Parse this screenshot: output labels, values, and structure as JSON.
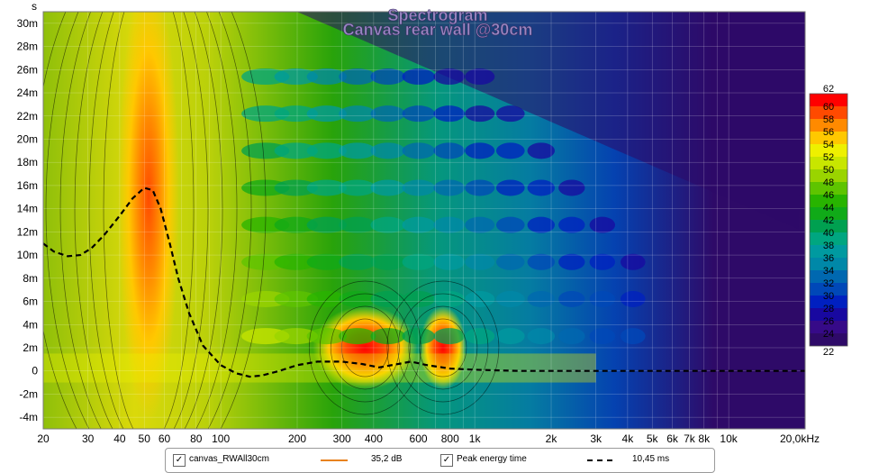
{
  "chart_data": {
    "type": "heatmap",
    "title": "Spectrogram",
    "subtitle": "Canvas rear wall @30cm",
    "x_axis": {
      "scale": "log",
      "range_hz": [
        20,
        20000
      ],
      "ticks": [
        {
          "v": 20,
          "label": "20"
        },
        {
          "v": 30,
          "label": "30"
        },
        {
          "v": 40,
          "label": "40"
        },
        {
          "v": 50,
          "label": "50"
        },
        {
          "v": 60,
          "label": "60"
        },
        {
          "v": 80,
          "label": "80"
        },
        {
          "v": 100,
          "label": "100"
        },
        {
          "v": 200,
          "label": "200"
        },
        {
          "v": 300,
          "label": "300"
        },
        {
          "v": 400,
          "label": "400"
        },
        {
          "v": 600,
          "label": "600"
        },
        {
          "v": 800,
          "label": "800"
        },
        {
          "v": 1000,
          "label": "1k"
        },
        {
          "v": 2000,
          "label": "2k"
        },
        {
          "v": 3000,
          "label": "3k"
        },
        {
          "v": 4000,
          "label": "4k"
        },
        {
          "v": 5000,
          "label": "5k"
        },
        {
          "v": 6000,
          "label": "6k"
        },
        {
          "v": 7000,
          "label": "7k"
        },
        {
          "v": 8000,
          "label": "8k"
        },
        {
          "v": 10000,
          "label": "10k"
        },
        {
          "v": 20000,
          "label": "20,0kHz"
        }
      ]
    },
    "y_axis": {
      "unit_label": "s",
      "range_ms": [
        -5,
        31
      ],
      "ticks": [
        {
          "v": 30,
          "label": "30m"
        },
        {
          "v": 28,
          "label": "28m"
        },
        {
          "v": 26,
          "label": "26m"
        },
        {
          "v": 24,
          "label": "24m"
        },
        {
          "v": 22,
          "label": "22m"
        },
        {
          "v": 20,
          "label": "20m"
        },
        {
          "v": 18,
          "label": "18m"
        },
        {
          "v": 16,
          "label": "16m"
        },
        {
          "v": 14,
          "label": "14m"
        },
        {
          "v": 12,
          "label": "12m"
        },
        {
          "v": 10,
          "label": "10m"
        },
        {
          "v": 8,
          "label": "8m"
        },
        {
          "v": 6,
          "label": "6m"
        },
        {
          "v": 4,
          "label": "4m"
        },
        {
          "v": 2,
          "label": "2m"
        },
        {
          "v": 0,
          "label": "0"
        },
        {
          "v": -2,
          "label": "-2m"
        },
        {
          "v": -4,
          "label": "-4m"
        }
      ]
    },
    "color_scale": {
      "unit": "dB",
      "min": 22,
      "max": 62,
      "levels": [
        {
          "db": 60,
          "color": "#ff0000"
        },
        {
          "db": 58,
          "color": "#ff4a00"
        },
        {
          "db": 56,
          "color": "#ff8a00"
        },
        {
          "db": 54,
          "color": "#ffc800"
        },
        {
          "db": 52,
          "color": "#eef000"
        },
        {
          "db": 50,
          "color": "#c8e600"
        },
        {
          "db": 48,
          "color": "#9ad400"
        },
        {
          "db": 46,
          "color": "#5ec400"
        },
        {
          "db": 44,
          "color": "#28b400"
        },
        {
          "db": 42,
          "color": "#10aa18"
        },
        {
          "db": 40,
          "color": "#00a050"
        },
        {
          "db": 38,
          "color": "#00a680"
        },
        {
          "db": 36,
          "color": "#009aa0"
        },
        {
          "db": 34,
          "color": "#0088a8"
        },
        {
          "db": 32,
          "color": "#0068b0"
        },
        {
          "db": 30,
          "color": "#0048b8"
        },
        {
          "db": 28,
          "color": "#0020c0"
        },
        {
          "db": 26,
          "color": "#1808a0"
        },
        {
          "db": 24,
          "color": "#360a88"
        }
      ],
      "ticks": [
        "62",
        "60",
        "58",
        "56",
        "54",
        "52",
        "50",
        "48",
        "46",
        "44",
        "42",
        "40",
        "38",
        "36",
        "34",
        "32",
        "30",
        "28",
        "26",
        "24",
        "22"
      ]
    },
    "background_color": "#2e0a68",
    "grid": true,
    "peak_energy_time": [
      {
        "f": 20,
        "t": 11.0
      },
      {
        "f": 22,
        "t": 10.3
      },
      {
        "f": 25,
        "t": 9.9
      },
      {
        "f": 28,
        "t": 10.0
      },
      {
        "f": 31,
        "t": 10.6
      },
      {
        "f": 35,
        "t": 11.8
      },
      {
        "f": 40,
        "t": 13.4
      },
      {
        "f": 45,
        "t": 14.9
      },
      {
        "f": 50,
        "t": 15.8
      },
      {
        "f": 54,
        "t": 15.6
      },
      {
        "f": 58,
        "t": 14.0
      },
      {
        "f": 63,
        "t": 11.0
      },
      {
        "f": 68,
        "t": 8.0
      },
      {
        "f": 75,
        "t": 5.0
      },
      {
        "f": 85,
        "t": 2.2
      },
      {
        "f": 100,
        "t": 0.5
      },
      {
        "f": 115,
        "t": -0.2
      },
      {
        "f": 130,
        "t": -0.5
      },
      {
        "f": 145,
        "t": -0.4
      },
      {
        "f": 170,
        "t": 0.0
      },
      {
        "f": 200,
        "t": 0.5
      },
      {
        "f": 240,
        "t": 0.8
      },
      {
        "f": 300,
        "t": 0.8
      },
      {
        "f": 360,
        "t": 0.6
      },
      {
        "f": 420,
        "t": 0.3
      },
      {
        "f": 500,
        "t": 0.6
      },
      {
        "f": 560,
        "t": 0.8
      },
      {
        "f": 650,
        "t": 0.5
      },
      {
        "f": 800,
        "t": 0.2
      },
      {
        "f": 1000,
        "t": 0.1
      },
      {
        "f": 1500,
        "t": 0.0
      },
      {
        "f": 2000,
        "t": 0.0
      },
      {
        "f": 3000,
        "t": 0.0
      },
      {
        "f": 5000,
        "t": 0.0
      },
      {
        "f": 10000,
        "t": 0.0
      },
      {
        "f": 20000,
        "t": 0.0
      }
    ],
    "peaks": [
      {
        "f": 52,
        "t": 10,
        "level_db": 58
      },
      {
        "f": 370,
        "t": 1,
        "level_db": 60
      },
      {
        "f": 750,
        "t": 1,
        "level_db": 60
      }
    ]
  },
  "legend": {
    "items": [
      {
        "label": "canvas_RWAll30cm",
        "value": "35,2 dB",
        "checked": true,
        "line_color": "#e8821e",
        "label_color": "#e8821e"
      },
      {
        "label": "Peak energy time",
        "value": "10,45 ms",
        "checked": true,
        "line_color": "#000000",
        "label_color": "#000000"
      }
    ],
    "check_mark": "✓"
  }
}
